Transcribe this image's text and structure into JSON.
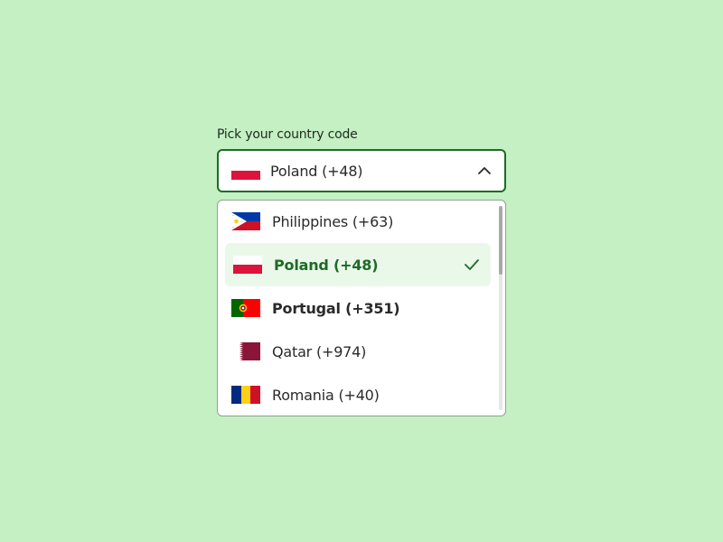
{
  "field": {
    "label": "Pick your country code",
    "selected_value": "Poland (+48)",
    "selected_flag_icon": "poland-flag-icon",
    "chevron_icon": "chevron-up-icon"
  },
  "dropdown": {
    "options": [
      {
        "label": "Philippines (+63)",
        "flag_icon": "philippines-flag-icon",
        "selected": false
      },
      {
        "label": "Poland (+48)",
        "flag_icon": "poland-flag-icon",
        "selected": true
      },
      {
        "label": "Portugal (+351)",
        "flag_icon": "portugal-flag-icon",
        "selected": false
      },
      {
        "label": "Qatar (+974)",
        "flag_icon": "qatar-flag-icon",
        "selected": false
      },
      {
        "label": "Romania (+40)",
        "flag_icon": "romania-flag-icon",
        "selected": false
      }
    ],
    "selected_check_icon": "check-icon"
  },
  "colors": {
    "background": "#c4f0c3",
    "accent": "#1e6a26",
    "selected_row_bg": "#eaf8ea"
  }
}
